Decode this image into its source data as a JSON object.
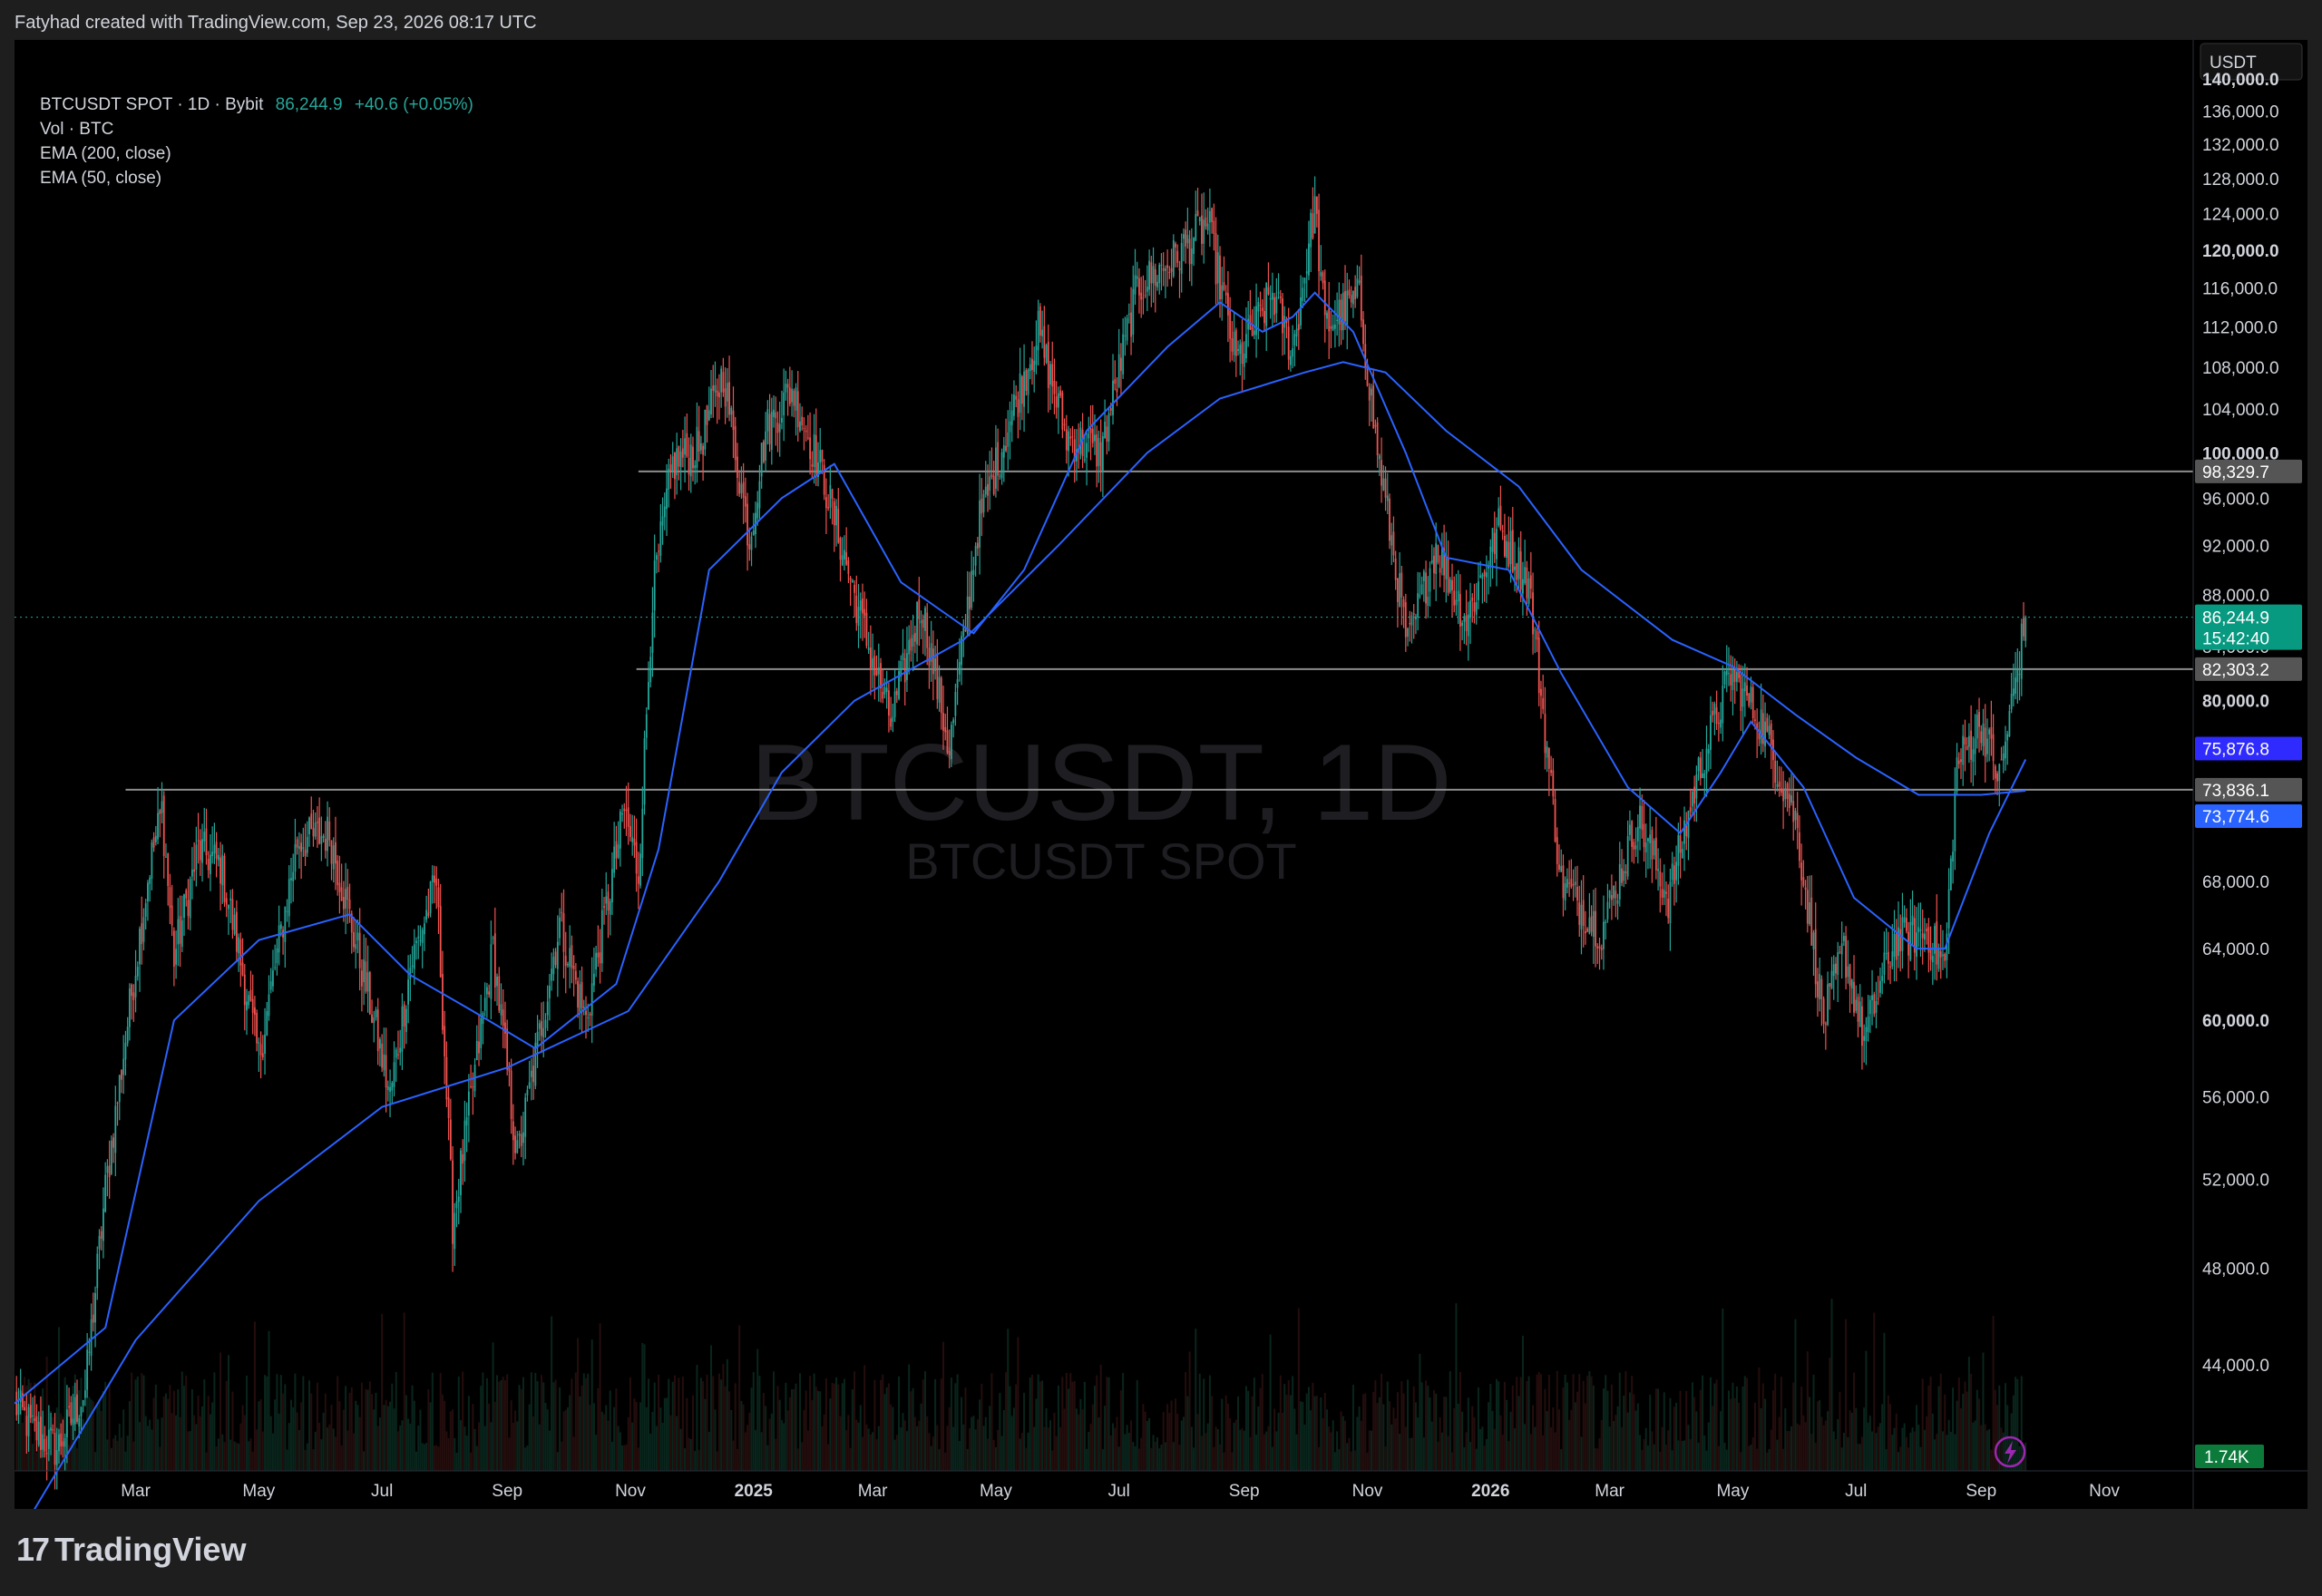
{
  "header": {
    "attribution": "Fatyhad created with TradingView.com, Sep 23, 2026 08:17 UTC"
  },
  "legend": {
    "symbol_line": "BTCUSDT SPOT · 1D · Bybit",
    "last_price": "86,244.9",
    "change": "+40.6 (+0.05%)",
    "volume_line": "Vol · BTC",
    "ema200_line": "EMA (200, close)",
    "ema50_line": "EMA (50, close)"
  },
  "watermark": {
    "main": "BTCUSDT, 1D",
    "sub": "BTCUSDT SPOT"
  },
  "footer": {
    "brand": "TradingView",
    "logo_mark": "17"
  },
  "price_axis": {
    "currency": "USDT",
    "ticks": [
      "140,000.0",
      "136,000.0",
      "132,000.0",
      "128,000.0",
      "124,000.0",
      "120,000.0",
      "116,000.0",
      "112,000.0",
      "108,000.0",
      "104,000.0",
      "100,000.0",
      "96,000.0",
      "92,000.0",
      "88,000.0",
      "84,000.0",
      "80,000.0",
      "68,000.0",
      "64,000.0",
      "60,000.0",
      "56,000.0",
      "52,000.0",
      "48,000.0",
      "44,000.0"
    ],
    "bold_ticks": [
      "140,000.0",
      "120,000.0",
      "100,000.0",
      "80,000.0",
      "60,000.0"
    ],
    "tags": {
      "level_98329": "98,329.7",
      "last": "86,244.9",
      "countdown": "15:42:40",
      "level_82303": "82,303.2",
      "ema50": "75,876.8",
      "level_73836": "73,836.1",
      "ema200": "73,774.6",
      "volume": "1.74K"
    }
  },
  "time_axis": {
    "ticks": [
      "Mar",
      "May",
      "Jul",
      "Sep",
      "Nov",
      "2025",
      "Mar",
      "May",
      "Jul",
      "Sep",
      "Nov",
      "2026",
      "Mar",
      "May",
      "Jul",
      "Sep",
      "Nov"
    ],
    "bold_ticks": [
      "2025",
      "2026"
    ]
  },
  "colors": {
    "up": "#26a69a",
    "down": "#ef5350",
    "ema": "#2962ff",
    "level": "#787b86",
    "background": "#000000"
  },
  "chart_data": {
    "type": "candlestick",
    "title": "BTCUSDT SPOT · 1D · Bybit",
    "yscale": "log",
    "ylim": [
      40000,
      145000
    ],
    "x_range": [
      "2024-01-01",
      "2026-12-15"
    ],
    "horizontal_levels": [
      98329.7,
      82303.2,
      73836.1
    ],
    "last_price": 86244.9,
    "ema_50_last": 75876.8,
    "ema_200_last": 73774.6,
    "volume_last": "1.74K",
    "price_path": [
      [
        "2024-01-01",
        42500
      ],
      [
        "2024-01-10",
        41500
      ],
      [
        "2024-01-22",
        40800
      ],
      [
        "2024-02-05",
        43000
      ],
      [
        "2024-02-15",
        51500
      ],
      [
        "2024-02-28",
        61500
      ],
      [
        "2024-03-08",
        69000
      ],
      [
        "2024-03-14",
        72500
      ],
      [
        "2024-03-20",
        63500
      ],
      [
        "2024-04-01",
        70000
      ],
      [
        "2024-04-12",
        69000
      ],
      [
        "2024-04-20",
        64500
      ],
      [
        "2024-05-01",
        58000
      ],
      [
        "2024-05-20",
        70500
      ],
      [
        "2024-06-05",
        71000
      ],
      [
        "2024-06-25",
        61000
      ],
      [
        "2024-07-05",
        56000
      ],
      [
        "2024-07-15",
        63000
      ],
      [
        "2024-07-28",
        68000
      ],
      [
        "2024-08-05",
        50000
      ],
      [
        "2024-08-25",
        64000
      ],
      [
        "2024-09-06",
        53000
      ],
      [
        "2024-09-27",
        65500
      ],
      [
        "2024-10-10",
        60000
      ],
      [
        "2024-10-29",
        72500
      ],
      [
        "2024-11-05",
        68500
      ],
      [
        "2024-11-12",
        88000
      ],
      [
        "2024-11-22",
        99000
      ],
      [
        "2024-12-05",
        100500
      ],
      [
        "2024-12-17",
        107500
      ],
      [
        "2024-12-30",
        92500
      ],
      [
        "2025-01-07",
        102000
      ],
      [
        "2025-01-20",
        106000
      ],
      [
        "2025-02-05",
        97500
      ],
      [
        "2025-02-26",
        84500
      ],
      [
        "2025-03-10",
        78500
      ],
      [
        "2025-03-25",
        87500
      ],
      [
        "2025-04-08",
        76500
      ],
      [
        "2025-04-22",
        93500
      ],
      [
        "2025-05-08",
        103000
      ],
      [
        "2025-05-22",
        111500
      ],
      [
        "2025-06-05",
        101500
      ],
      [
        "2025-06-22",
        100000
      ],
      [
        "2025-07-10",
        116000
      ],
      [
        "2025-07-28",
        119000
      ],
      [
        "2025-08-14",
        123000
      ],
      [
        "2025-08-28",
        108500
      ],
      [
        "2025-09-15",
        115500
      ],
      [
        "2025-09-25",
        109500
      ],
      [
        "2025-10-06",
        125000
      ],
      [
        "2025-10-11",
        112000
      ],
      [
        "2025-10-28",
        115000
      ],
      [
        "2025-11-05",
        101500
      ],
      [
        "2025-11-21",
        84000
      ],
      [
        "2025-12-05",
        92000
      ],
      [
        "2025-12-20",
        86000
      ],
      [
        "2026-01-05",
        93500
      ],
      [
        "2026-01-20",
        89000
      ],
      [
        "2026-02-05",
        68000
      ],
      [
        "2026-02-25",
        65000
      ],
      [
        "2026-03-15",
        72000
      ],
      [
        "2026-03-30",
        67000
      ],
      [
        "2026-04-15",
        75500
      ],
      [
        "2026-04-30",
        82000
      ],
      [
        "2026-05-15",
        78500
      ],
      [
        "2026-06-01",
        72000
      ],
      [
        "2026-06-15",
        60000
      ],
      [
        "2026-06-25",
        64000
      ],
      [
        "2026-07-05",
        59000
      ],
      [
        "2026-07-20",
        64500
      ],
      [
        "2026-08-05",
        65000
      ],
      [
        "2026-08-14",
        63000
      ],
      [
        "2026-08-20",
        75500
      ],
      [
        "2026-09-01",
        78500
      ],
      [
        "2026-09-10",
        74500
      ],
      [
        "2026-09-18",
        81500
      ],
      [
        "2026-09-23",
        86244.9
      ]
    ],
    "series": [
      {
        "name": "EMA (50, close)",
        "points": [
          [
            "2024-01-01",
            42500
          ],
          [
            "2024-02-15",
            45500
          ],
          [
            "2024-03-20",
            60000
          ],
          [
            "2024-05-01",
            64500
          ],
          [
            "2024-06-15",
            66000
          ],
          [
            "2024-07-15",
            62500
          ],
          [
            "2024-08-15",
            60500
          ],
          [
            "2024-09-15",
            58500
          ],
          [
            "2024-10-25",
            62000
          ],
          [
            "2024-11-15",
            70000
          ],
          [
            "2024-12-10",
            90000
          ],
          [
            "2025-01-15",
            96000
          ],
          [
            "2025-02-10",
            99000
          ],
          [
            "2025-03-15",
            89000
          ],
          [
            "2025-04-20",
            85000
          ],
          [
            "2025-05-15",
            90000
          ],
          [
            "2025-06-15",
            102000
          ],
          [
            "2025-07-25",
            110000
          ],
          [
            "2025-08-20",
            114500
          ],
          [
            "2025-09-10",
            111500
          ],
          [
            "2025-09-25",
            113000
          ],
          [
            "2025-10-06",
            115500
          ],
          [
            "2025-10-25",
            111500
          ],
          [
            "2025-11-20",
            100000
          ],
          [
            "2025-12-10",
            91000
          ],
          [
            "2026-01-10",
            90000
          ],
          [
            "2026-02-05",
            82000
          ],
          [
            "2026-03-10",
            74000
          ],
          [
            "2026-04-05",
            71000
          ],
          [
            "2026-04-25",
            75000
          ],
          [
            "2026-05-10",
            78500
          ],
          [
            "2026-06-05",
            74000
          ],
          [
            "2026-06-30",
            67000
          ],
          [
            "2026-07-31",
            64000
          ],
          [
            "2026-08-14",
            64000
          ],
          [
            "2026-09-05",
            71000
          ],
          [
            "2026-09-23",
            75876.8
          ]
        ]
      },
      {
        "name": "EMA (200, close)",
        "points": [
          [
            "2024-01-01",
            37500
          ],
          [
            "2024-03-01",
            45000
          ],
          [
            "2024-05-01",
            51000
          ],
          [
            "2024-07-01",
            55500
          ],
          [
            "2024-09-01",
            57500
          ],
          [
            "2024-10-31",
            60500
          ],
          [
            "2024-12-15",
            68000
          ],
          [
            "2025-01-15",
            75000
          ],
          [
            "2025-02-20",
            80000
          ],
          [
            "2025-04-15",
            84500
          ],
          [
            "2025-06-01",
            92000
          ],
          [
            "2025-07-15",
            100000
          ],
          [
            "2025-08-20",
            105000
          ],
          [
            "2025-10-01",
            107500
          ],
          [
            "2025-10-20",
            108500
          ],
          [
            "2025-11-10",
            107500
          ],
          [
            "2025-12-10",
            102000
          ],
          [
            "2026-01-15",
            97000
          ],
          [
            "2026-02-15",
            90000
          ],
          [
            "2026-04-01",
            84500
          ],
          [
            "2026-05-01",
            82500
          ],
          [
            "2026-06-01",
            79000
          ],
          [
            "2026-07-01",
            76000
          ],
          [
            "2026-08-01",
            73500
          ],
          [
            "2026-09-01",
            73500
          ],
          [
            "2026-09-23",
            73774.6
          ]
        ]
      }
    ]
  }
}
